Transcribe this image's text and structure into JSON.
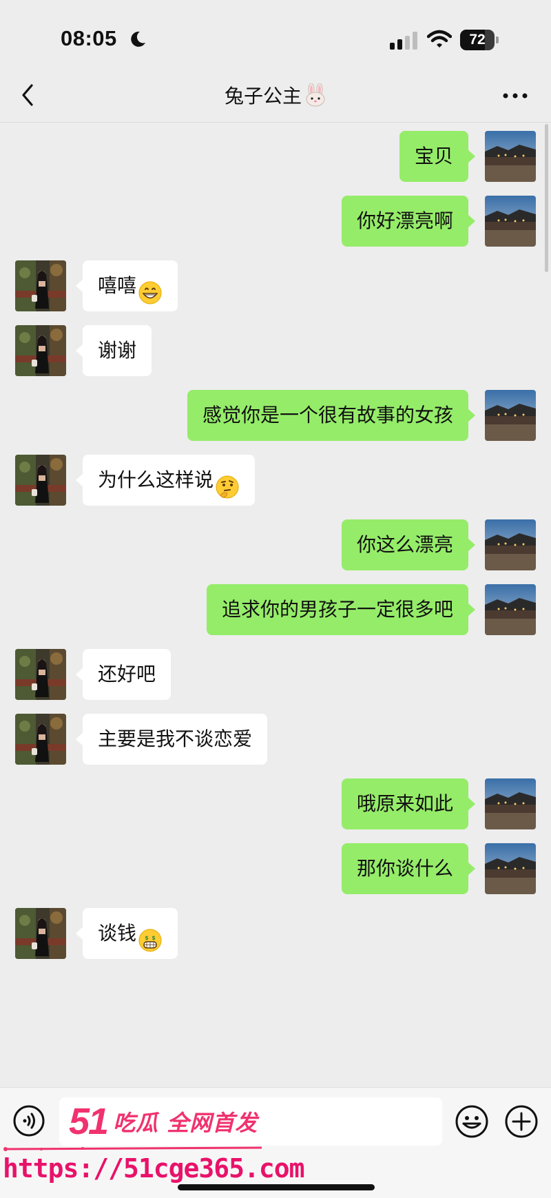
{
  "status_bar": {
    "time": "08:05",
    "battery_level": "72",
    "battery_fraction": 0.72
  },
  "header": {
    "title": "兔子公主",
    "title_icon": "bunny-face-icon",
    "back_icon": "chevron-left-icon",
    "more_icon": "more-dots-icon"
  },
  "messages": [
    {
      "side": "right",
      "text": "宝贝"
    },
    {
      "side": "right",
      "text": "你好漂亮啊"
    },
    {
      "side": "left",
      "text": "嘻嘻",
      "emoji": "grinning-face-icon"
    },
    {
      "side": "left",
      "text": "谢谢"
    },
    {
      "side": "right",
      "text": "感觉你是一个很有故事的女孩"
    },
    {
      "side": "left",
      "text": "为什么这样说",
      "emoji": "thinking-face-icon"
    },
    {
      "side": "right",
      "text": "你这么漂亮"
    },
    {
      "side": "right",
      "text": "追求你的男孩子一定很多吧"
    },
    {
      "side": "left",
      "text": "还好吧"
    },
    {
      "side": "left",
      "text": "主要是我不谈恋爱"
    },
    {
      "side": "right",
      "text": "哦原来如此"
    },
    {
      "side": "right",
      "text": "那你谈什么"
    },
    {
      "side": "left",
      "text": "谈钱",
      "emoji": "money-mouth-face-icon"
    }
  ],
  "input_bar": {
    "voice_icon": "voice-icon",
    "emoji_icon": "smiley-icon",
    "plus_icon": "plus-circle-icon",
    "input_value": ""
  },
  "watermark": {
    "number": "51",
    "text": "吃瓜 全网首发",
    "url": "https://51cge365.com"
  },
  "colors": {
    "background": "#ededed",
    "outgoing_bubble": "#95ec69",
    "incoming_bubble": "#ffffff",
    "watermark": "#f0326e"
  }
}
